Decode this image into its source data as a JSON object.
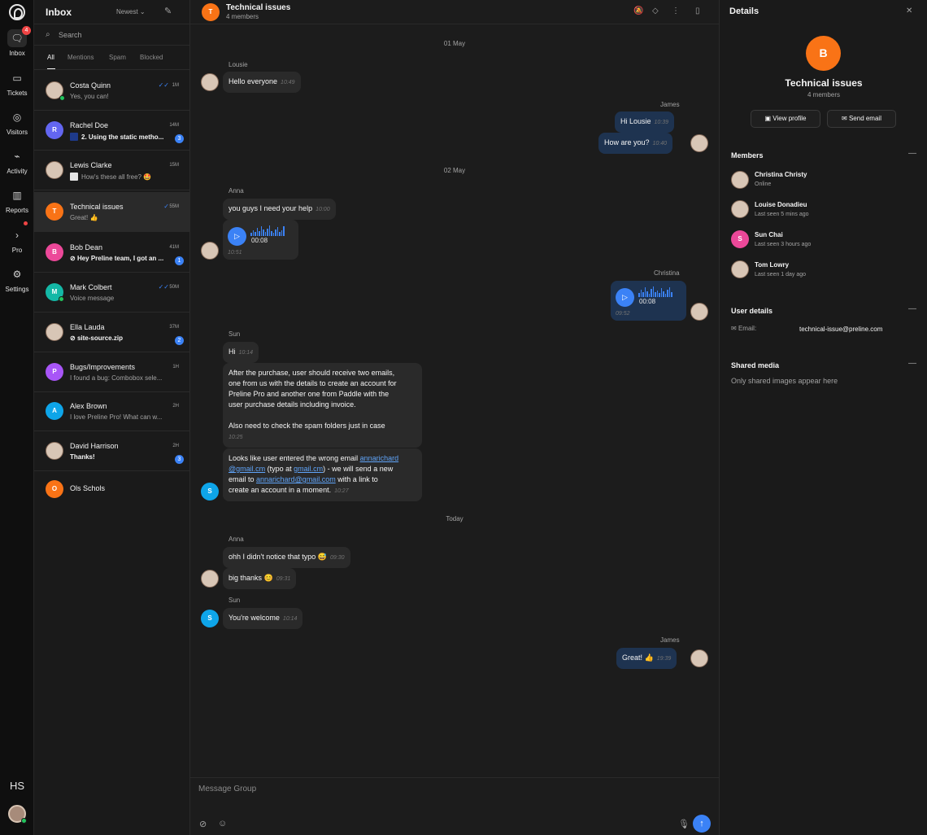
{
  "rail": {
    "items": [
      {
        "label": "Inbox",
        "icon": "chat-icon",
        "badge": "4"
      },
      {
        "label": "Tickets",
        "icon": "ticket-icon"
      },
      {
        "label": "Visitors",
        "icon": "globe-icon"
      },
      {
        "label": "Activity",
        "icon": "pulse-icon"
      },
      {
        "label": "Reports",
        "icon": "bar-chart-icon"
      },
      {
        "label": "Pro",
        "icon": "chevron-right-icon"
      },
      {
        "label": "Settings",
        "icon": "sliders-icon"
      }
    ],
    "hs_label": "HS"
  },
  "inbox": {
    "title": "Inbox",
    "sort_label": "Newest",
    "search_placeholder": "Search",
    "filters": [
      "All",
      "Mentions",
      "Spam",
      "Blocked"
    ],
    "conversations": [
      {
        "name": "Costa Quinn",
        "preview": "Yes, you can!",
        "time": "1M",
        "read": "✓✓"
      },
      {
        "name": "Rachel Doe",
        "initial": "R",
        "preview": "2. Using the static metho...",
        "time": "14M",
        "badge": "3"
      },
      {
        "name": "Lewis Clarke",
        "preview": "How's these all free? 🤩",
        "time": "15M"
      },
      {
        "name": "Technical issues",
        "initial": "T",
        "preview": "Great! 👍",
        "time": "55M",
        "read": "✓"
      },
      {
        "name": "Bob Dean",
        "initial": "B",
        "preview": "Hey Preline team, I got an ...",
        "time": "41M",
        "badge": "1"
      },
      {
        "name": "Mark Colbert",
        "initial": "M",
        "preview": "Voice message",
        "time": "50M",
        "read": "✓✓"
      },
      {
        "name": "Ella Lauda",
        "preview": "site-source.zip",
        "time": "37M",
        "badge": "2"
      },
      {
        "name": "Bugs/Improvements",
        "initial": "P",
        "preview": "I found a bug: Combobox sele...",
        "time": "1H"
      },
      {
        "name": "Alex Brown",
        "initial": "A",
        "preview": "I love Preline Pro! What can w...",
        "time": "2H"
      },
      {
        "name": "David Harrison",
        "preview": "Thanks!",
        "time": "2H",
        "badge": "3"
      },
      {
        "name": "Ols Schols",
        "initial": "O"
      }
    ]
  },
  "chat": {
    "title": "Technical issues",
    "avatar_initial": "T",
    "subtitle": "4 members",
    "dates": [
      "01 May",
      "02 May",
      "Today"
    ],
    "senders": {
      "lousie": "Lousie",
      "james": "James",
      "anna": "Anna",
      "christina": "Christina",
      "sun": "Sun"
    },
    "messages": {
      "m1": {
        "text": "Hello everyone",
        "time": "10:49"
      },
      "m2": {
        "text": "Hi Lousie",
        "time": "10:39"
      },
      "m3": {
        "text": "How are you?",
        "time": "10:40"
      },
      "m4": {
        "text": "you guys I need your help",
        "time": "10:00"
      },
      "m5": {
        "duration": "00:08",
        "time": "10:51"
      },
      "m6": {
        "duration": "00:08",
        "time": "09:52"
      },
      "m7": {
        "text": "Hi",
        "time": "10:14"
      },
      "m8": {
        "text1": "After the purchase, user should receive two emails,",
        "text2": "one from us with the details to create an account for",
        "text3": "Preline Pro and another one from Paddle with the",
        "text4": "user purchase details including invoice.",
        "text5": "Also need to check the spam folders just in case",
        "time": "10:25"
      },
      "m9": {
        "l1a": "Looks like user entered the wrong email ",
        "l1link": "annarichard",
        "l2link": "@gmail.cm",
        "l2b": " (typo at ",
        "l2link2": "gmail.cm",
        "l2c": ") - we will send a new",
        "l3a": "email to ",
        "l3link": "annarichard@gmail.com",
        "l3b": " with a link to",
        "l4a": "create an account in a moment.",
        "time": "10:27"
      },
      "m10": {
        "text": "ohh I didn't notice that typo 😅",
        "time": "09:30"
      },
      "m11": {
        "text": "big thanks 😊",
        "time": "09:31"
      },
      "m12": {
        "text": "You're welcome",
        "time": "10:14"
      },
      "m13": {
        "text": "Great! 👍",
        "time": "19:39"
      }
    },
    "composer_placeholder": "Message Group"
  },
  "details": {
    "title": "Details",
    "avatar_initial": "B",
    "name": "Technical issues",
    "members_count": "4 members",
    "view_profile": "View profile",
    "send_email": "Send email",
    "members_title": "Members",
    "members": [
      {
        "name": "Christina Christy",
        "status": "Online"
      },
      {
        "name": "Louise Donadieu",
        "status": "Last seen 5 mins ago"
      },
      {
        "name": "Sun Chai",
        "initial": "S",
        "status": "Last seen 3 hours ago"
      },
      {
        "name": "Tom Lowry",
        "status": "Last seen 1 day ago"
      }
    ],
    "user_details_title": "User details",
    "email_label": "Email:",
    "email_value": "technical-issue@preline.com",
    "shared_media_title": "Shared media",
    "shared_media_empty": "Only shared images appear here"
  },
  "colors": {
    "accent": "#3b82f6",
    "orange": "#f97316",
    "online": "#22c55e",
    "badge_red": "#ef4444"
  }
}
